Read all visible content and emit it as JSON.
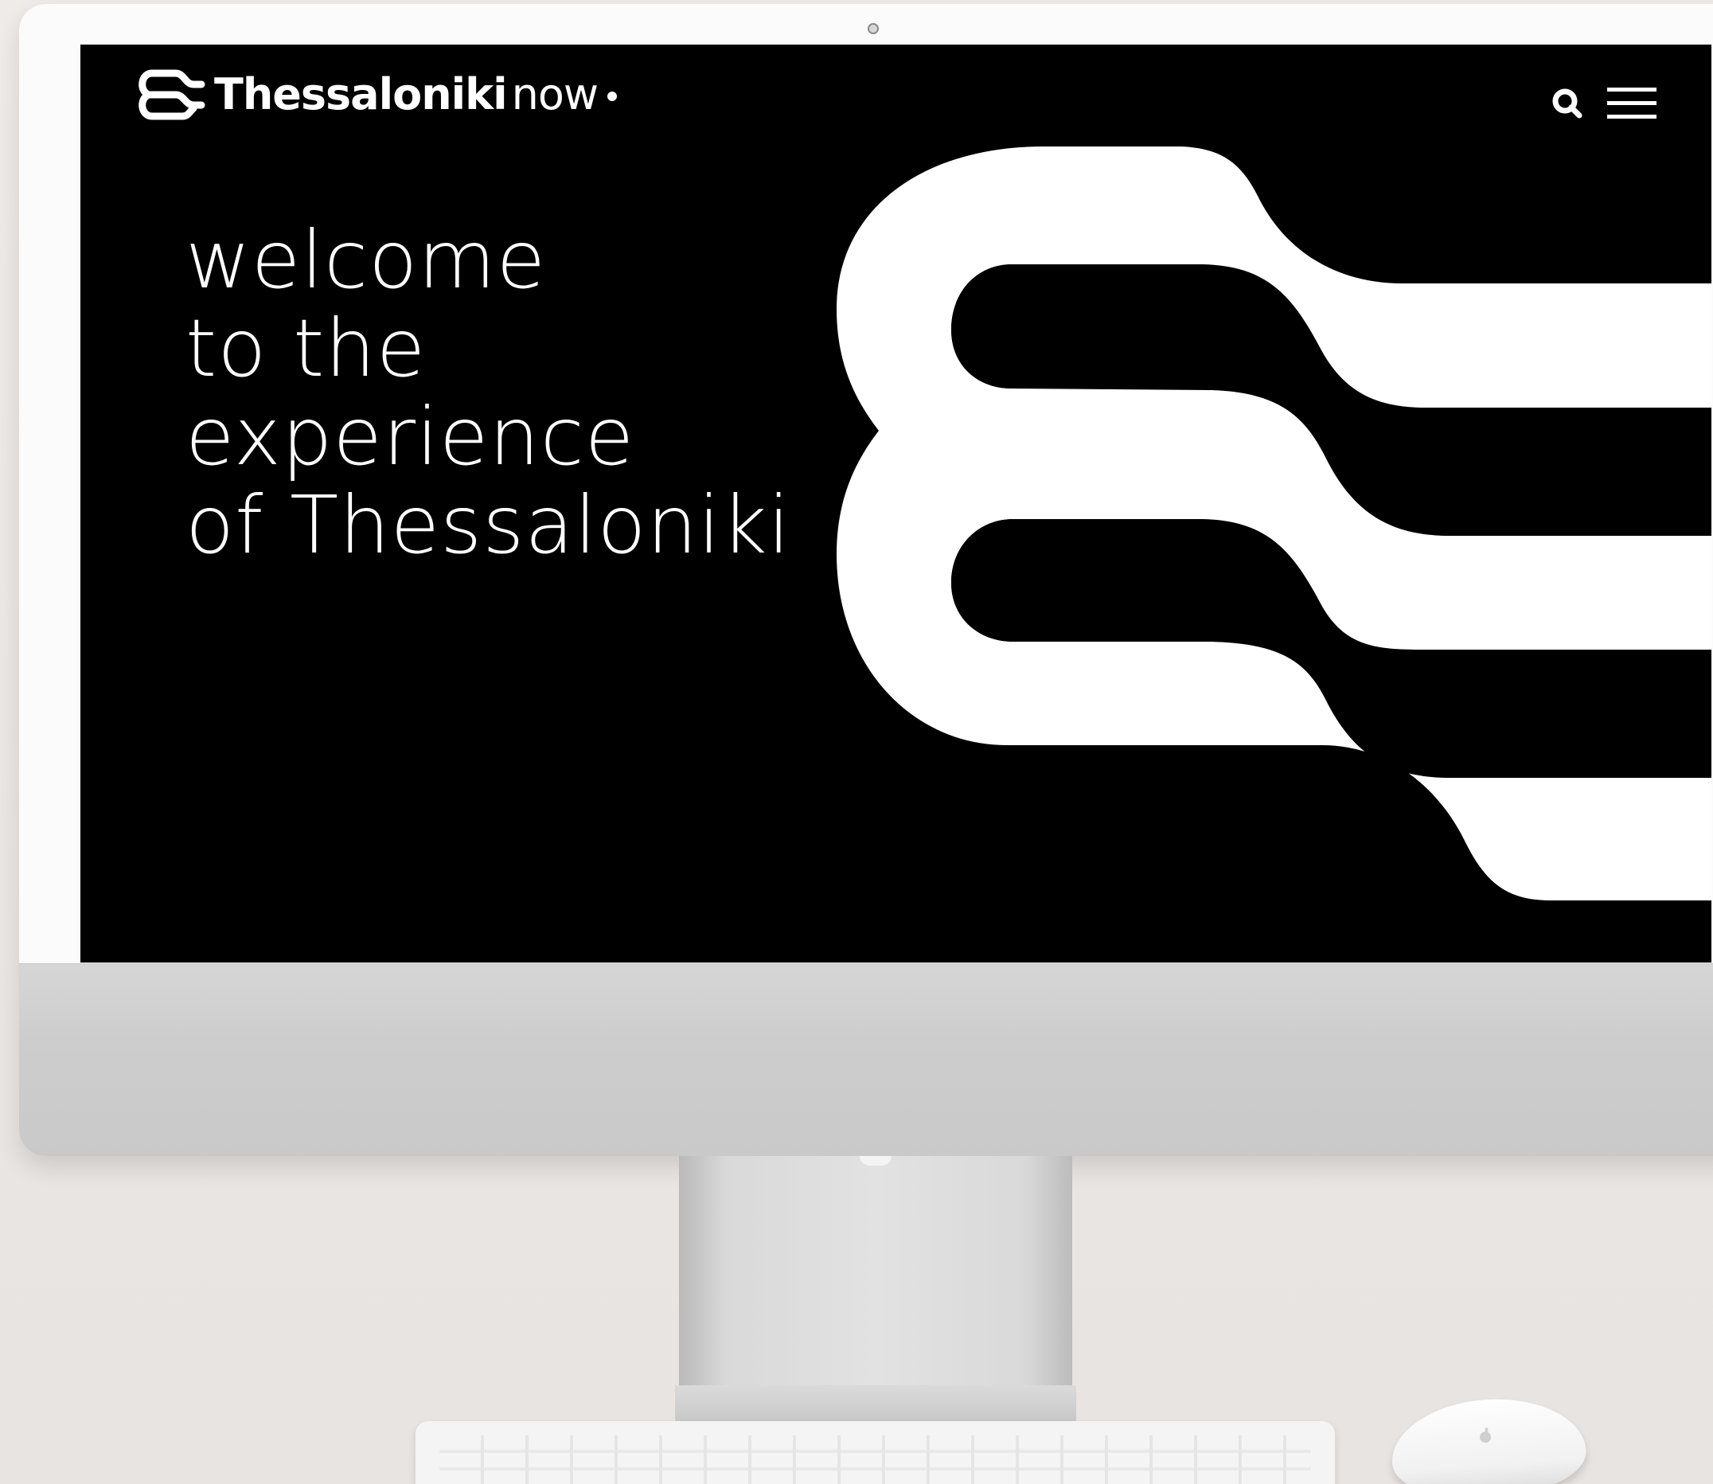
{
  "site": {
    "logo": {
      "wordmark_bold": "Thessaloniki",
      "wordmark_light": "now"
    },
    "header": {
      "search_icon": "search-icon",
      "menu_icon": "hamburger-menu-icon"
    },
    "hero": {
      "line1": "welcome",
      "line2": "to the",
      "line3": "experience",
      "line4": "of Thessaloniki"
    }
  },
  "colors": {
    "screen_background": "#000000",
    "foreground": "#ffffff",
    "backdrop": "#ece8e6",
    "device_silver": "#cdcdcd"
  }
}
